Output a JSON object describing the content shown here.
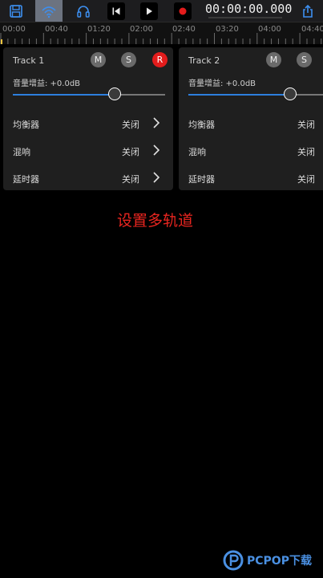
{
  "toolbar": {
    "buttons": [
      {
        "icon": "save-icon"
      },
      {
        "icon": "wifi-icon",
        "active": true
      },
      {
        "icon": "headphones-icon"
      },
      {
        "icon": "skip-back-icon"
      },
      {
        "icon": "play-icon"
      },
      {
        "icon": "record-icon"
      },
      {
        "icon": "share-icon"
      }
    ],
    "timecode": "00:00:00.000"
  },
  "ruler": {
    "labels": [
      "00:00",
      "00:40",
      "01:20",
      "02:00",
      "02:40",
      "03:20",
      "04:00",
      "04:40"
    ]
  },
  "tracks": [
    {
      "name": "Track 1",
      "mute_label": "M",
      "solo_label": "S",
      "record_label": "R",
      "gain_label": "音量增益: +0.0dB",
      "gain_level": 0.67,
      "effects": [
        {
          "name": "均衡器",
          "state": "关闭"
        },
        {
          "name": "混响",
          "state": "关闭"
        },
        {
          "name": "延时器",
          "state": "关闭"
        }
      ]
    },
    {
      "name": "Track 2",
      "mute_label": "M",
      "solo_label": "S",
      "gain_label": "音量增益: +0.0dB",
      "gain_level": 0.67,
      "effects": [
        {
          "name": "均衡器",
          "state": "关闭"
        },
        {
          "name": "混响",
          "state": "关闭"
        },
        {
          "name": "延时器",
          "state": "关闭"
        }
      ]
    }
  ],
  "caption": "设置多轨道",
  "watermark": "PCPOP下载",
  "colors": {
    "accent": "#2d7fdd",
    "record": "#e31c1c",
    "caption": "#e8251f",
    "playhead": "#f3c53d"
  }
}
